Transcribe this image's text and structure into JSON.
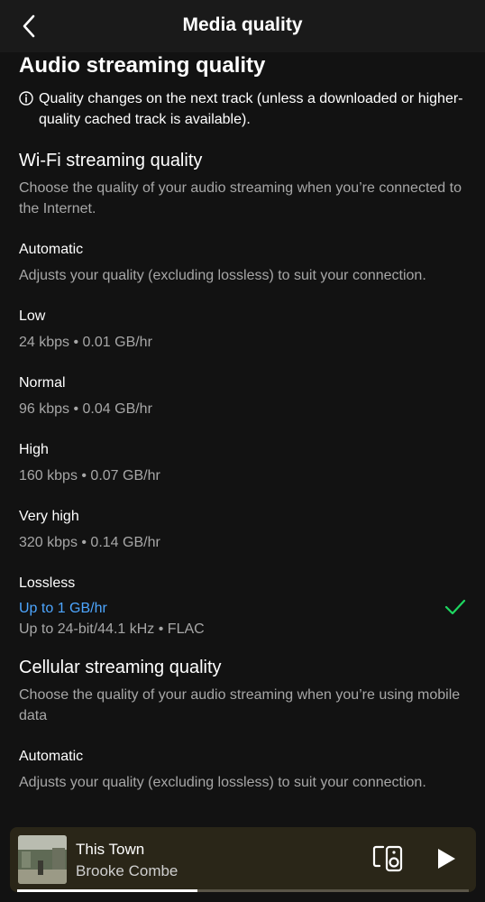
{
  "header": {
    "title": "Media quality",
    "back_icon": "chevron-left-icon"
  },
  "audio": {
    "title": "Audio streaming quality",
    "notice": "Quality changes on the next track (unless a downloaded or higher-quality cached track is available).",
    "notice_icon": "info-icon"
  },
  "wifi": {
    "title": "Wi-Fi streaming quality",
    "desc": "Choose the quality of your audio streaming when you’re connected to the Internet.",
    "options": [
      {
        "name": "Automatic",
        "desc": "Adjusts your quality (excluding lossless) to suit your connection."
      },
      {
        "name": "Low",
        "desc": "24 kbps • 0.01 GB/hr"
      },
      {
        "name": "Normal",
        "desc": "96 kbps • 0.04 GB/hr"
      },
      {
        "name": "High",
        "desc": "160 kbps • 0.07 GB/hr"
      },
      {
        "name": "Very high",
        "desc": "320 kbps • 0.14 GB/hr"
      },
      {
        "name": "Lossless",
        "tag": "Up to 1 GB/hr",
        "desc": "Up to 24-bit/44.1 kHz • FLAC",
        "selected": true
      }
    ]
  },
  "cellular": {
    "title": "Cellular streaming quality",
    "desc": "Choose the quality of your audio streaming when you’re using mobile data",
    "options": [
      {
        "name": "Automatic",
        "desc": "Adjusts your quality (excluding lossless) to suit your connection."
      }
    ]
  },
  "player": {
    "track": "This Town",
    "artist": "Brooke Combe",
    "progress": 0.4,
    "devices_icon": "connect-devices-icon",
    "play_icon": "play-icon"
  },
  "colors": {
    "background": "#121212",
    "accent_green": "#1ed760",
    "tag_blue": "#4da6ff",
    "secondary_text": "#a7a7a7"
  }
}
